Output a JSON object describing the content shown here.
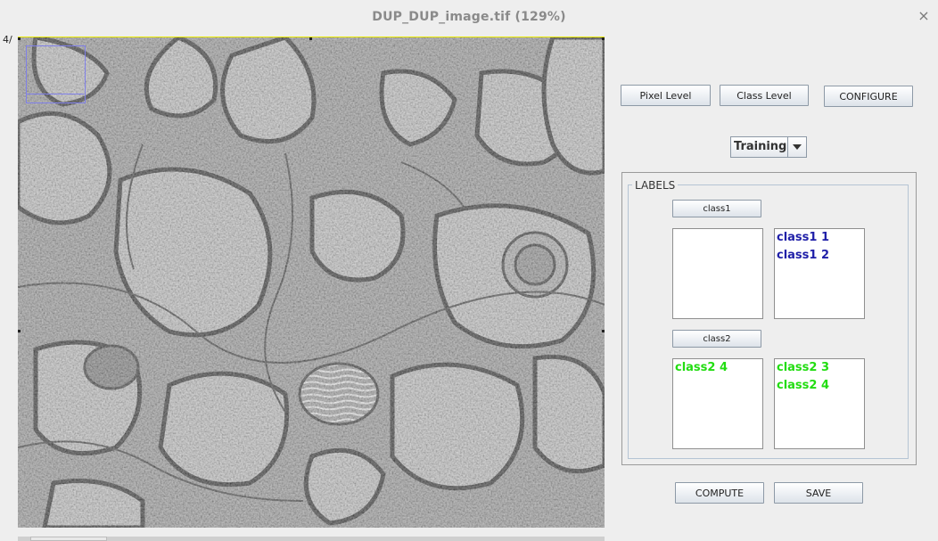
{
  "window": {
    "title": "DUP_DUP_image.tif (129%)",
    "close_glyph": "×"
  },
  "image": {
    "slice_label": "4/"
  },
  "toolbar": {
    "pixel_level": "Pixel Level",
    "class_level": "Class Level",
    "configure": "CONFIGURE"
  },
  "mode": {
    "selected": "Training"
  },
  "labels": {
    "title": "LABELS",
    "class1": {
      "button": "class1",
      "left_items": [],
      "right_items": [
        "class1 1",
        "class1 2"
      ],
      "color": "#1f1fa8"
    },
    "class2": {
      "button": "class2",
      "left_items": [
        "class2 4"
      ],
      "right_items": [
        "class2 3",
        "class2 4"
      ],
      "color": "#22dd11"
    }
  },
  "actions": {
    "compute": "COMPUTE",
    "save": "SAVE"
  }
}
